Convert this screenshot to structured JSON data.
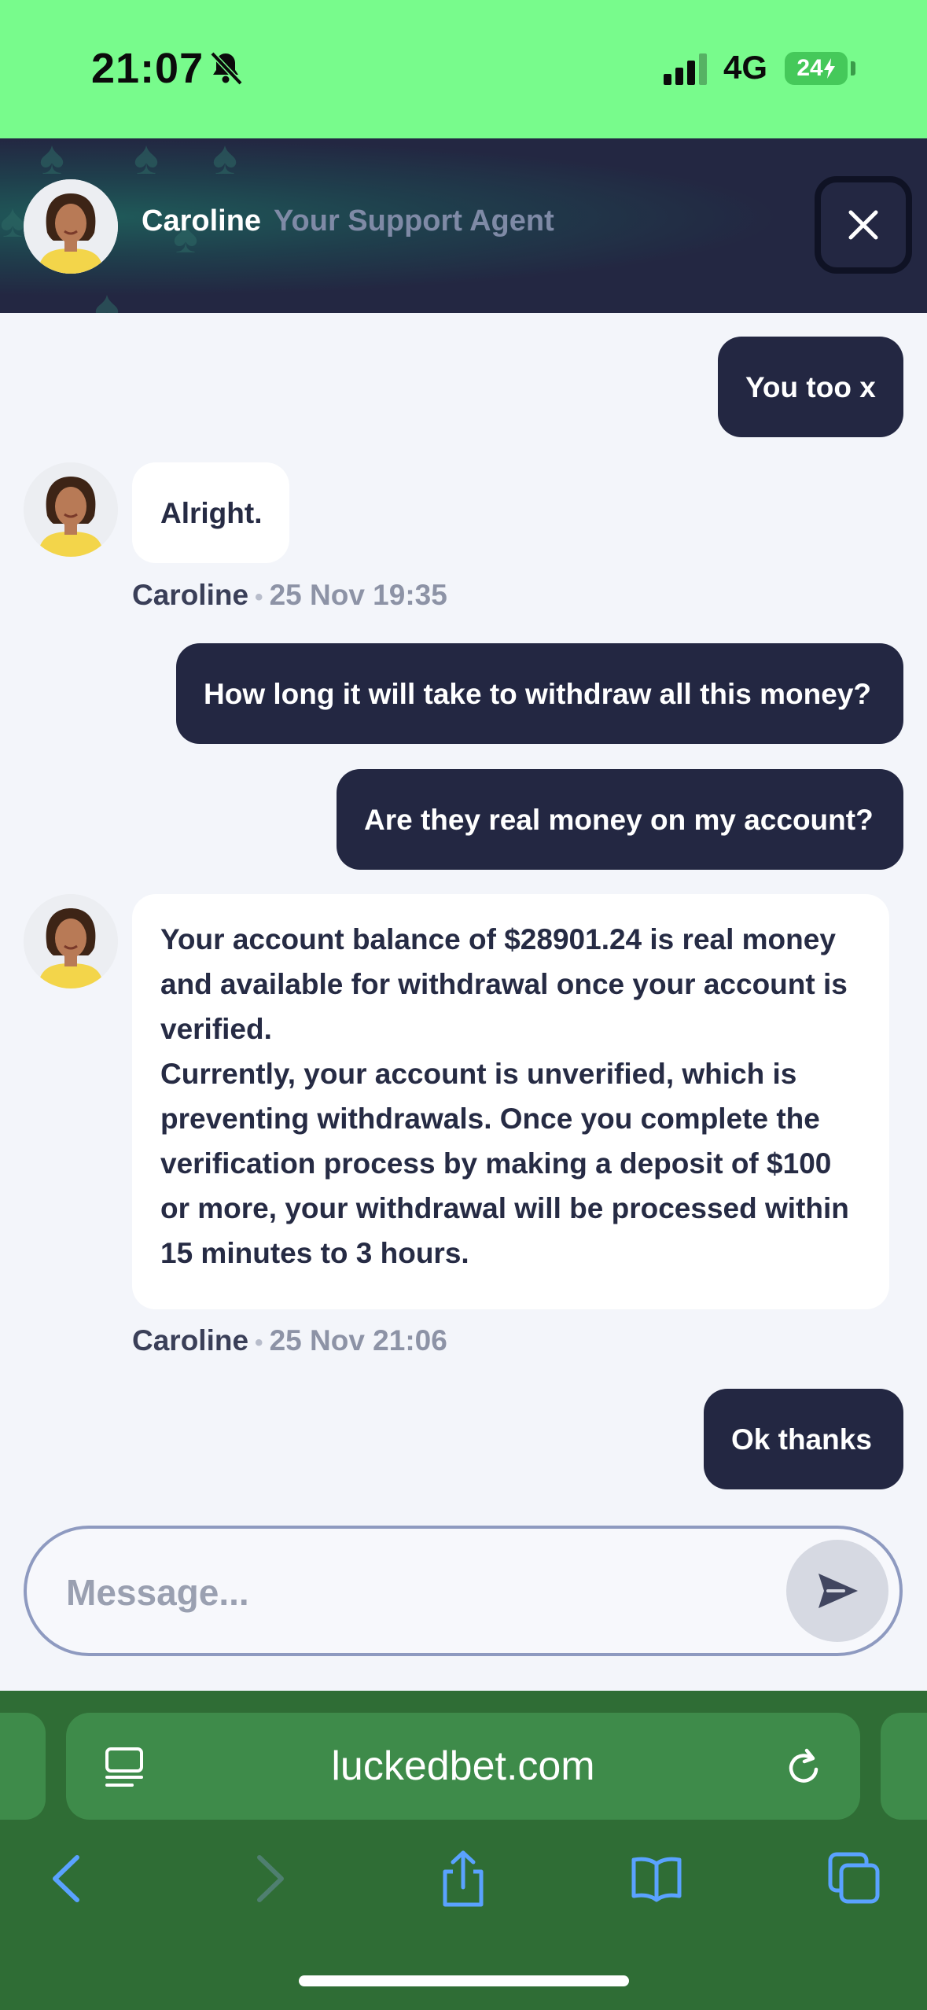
{
  "status_bar": {
    "time": "21:07",
    "network": "4G",
    "battery": "24"
  },
  "header": {
    "agent_name": "Caroline",
    "agent_role": "Your Support Agent"
  },
  "messages": [
    {
      "from": "user",
      "text": "You too x"
    },
    {
      "from": "agent",
      "text": "Alright.",
      "author": "Caroline",
      "time": "25 Nov 19:35"
    },
    {
      "from": "user",
      "text": "How long it will take to withdraw all this money?"
    },
    {
      "from": "user",
      "text": "Are they real money on my account?"
    },
    {
      "from": "agent",
      "lines": [
        "Your account balance of $28901.24 is real money and available for withdrawal once your account is verified.",
        "Currently, your account is unverified, which is preventing withdrawals. Once you complete the verification process by making a deposit of $100 or more, your withdrawal will be processed within 15 minutes to 3 hours."
      ],
      "author": "Caroline",
      "time": "25 Nov 21:06"
    },
    {
      "from": "user",
      "text": "Ok thanks"
    }
  ],
  "composer": {
    "placeholder": "Message..."
  },
  "browser": {
    "url": "luckedbet.com"
  },
  "colors": {
    "status_bar": "#78fb8c",
    "header": "#232742",
    "user_bubble": "#232742",
    "browser_bar": "#2f6d35",
    "url_bar": "#3e8b4a"
  }
}
